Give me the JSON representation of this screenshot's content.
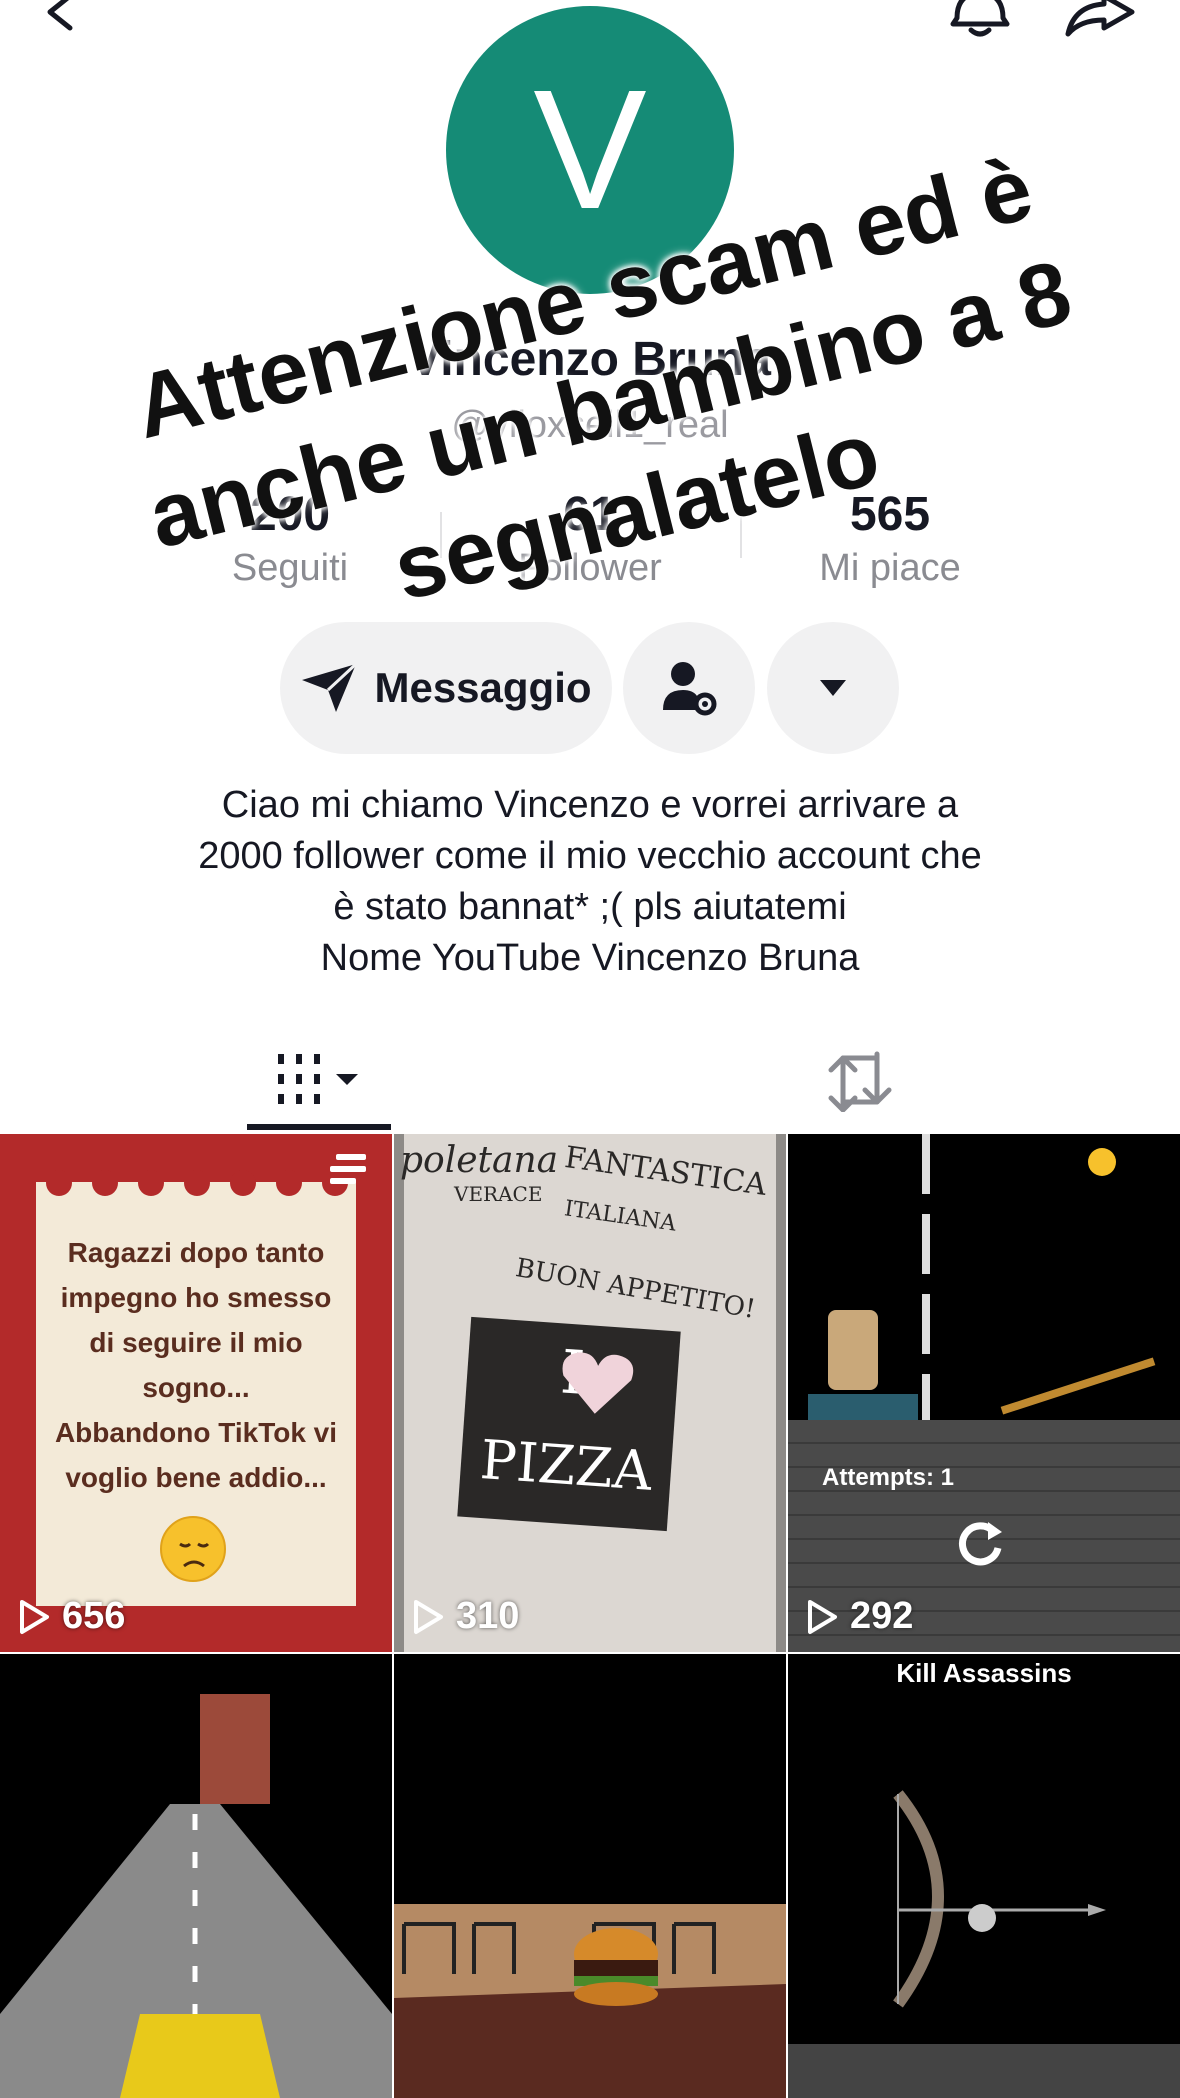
{
  "profile": {
    "avatar_letter": "V",
    "avatar_color": "#158b76",
    "name": "Vincenzo Bruna",
    "handle": "@viloxseil1_real",
    "stats": [
      {
        "value": "200",
        "label": "Seguiti"
      },
      {
        "value": "61",
        "label": "Follower"
      },
      {
        "value": "565",
        "label": "Mi piace"
      }
    ],
    "bio": "Ciao mi chiamo Vincenzo e vorrei arrivare a\n2000 follower come il mio vecchio account che\nè stato bannat* ;( pls aiutatemi\nNome YouTube Vincenzo Bruna"
  },
  "actions": {
    "message_label": "Messaggio",
    "follow_icon": "person-gear-icon",
    "more_icon": "caret-down-icon"
  },
  "topbar": {
    "icons": [
      "back-arrow-icon",
      "bell-icon",
      "share-icon"
    ]
  },
  "tabs": [
    {
      "icon": "grid-icon",
      "active": true
    },
    {
      "icon": "repost-icon",
      "active": false
    }
  ],
  "videos": [
    {
      "views": "656",
      "note_text": "Ragazzi dopo tanto\nimpegno ho smesso\ndi seguire il mio\nsogno...\nAbbandono TikTok vi\nvoglio bene addio..."
    },
    {
      "views": "310",
      "pizza_text_1": "I",
      "pizza_text_2": "PIZZA",
      "scribble_1": "poletana",
      "scribble_2": "FANTASTICA",
      "scribble_3": "ITALIANA",
      "scribble_4": "BUON APPETITO!",
      "scribble_5": "VERACE"
    },
    {
      "views": "292",
      "caption": "Attempts: 1"
    },
    {
      "views": ""
    },
    {
      "views": ""
    },
    {
      "views": "",
      "caption": "Kill Assassins"
    }
  ],
  "overlay": {
    "text": "Attenzione scam ed è\nanche un bambino a 8\nsegnalatelo"
  }
}
